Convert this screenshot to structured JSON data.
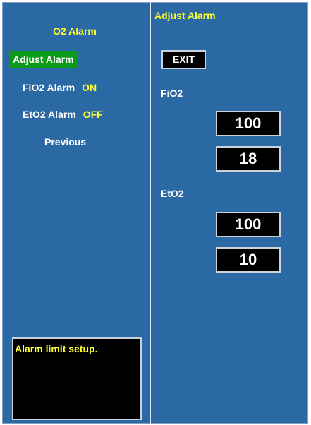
{
  "left_panel": {
    "title": "O2 Alarm",
    "menu": {
      "adjust_alarm": "Adjust Alarm",
      "fio2_alarm_label": "FiO2 Alarm",
      "fio2_alarm_state": "ON",
      "eto2_alarm_label": "EtO2 Alarm",
      "eto2_alarm_state": "OFF",
      "previous": "Previous"
    },
    "message": "Alarm limit setup."
  },
  "right_panel": {
    "title": "Adjust Alarm",
    "exit_label": "EXIT",
    "fio2": {
      "label": "FiO2",
      "high": "100",
      "low": "18"
    },
    "eto2": {
      "label": "EtO2",
      "high": "100",
      "low": "10"
    }
  },
  "colors": {
    "background": "#2b69a4",
    "highlight_text": "#ffff33",
    "selected_item": "#0b9a1a",
    "value_box": "#000000"
  }
}
